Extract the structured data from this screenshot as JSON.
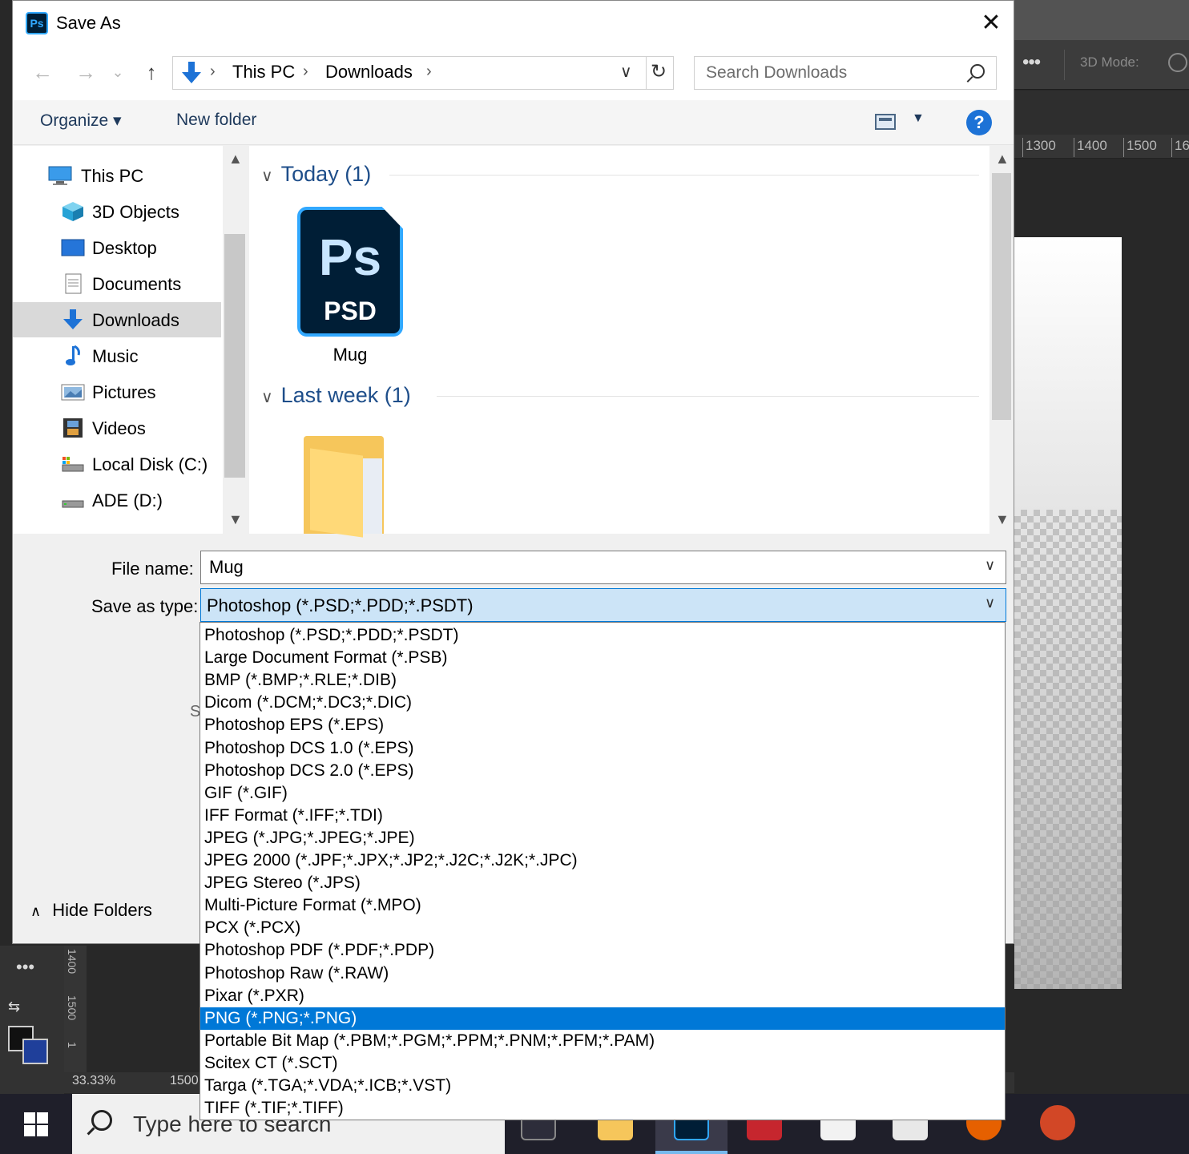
{
  "dialog": {
    "title": "Save As",
    "app_icon_text": "Ps",
    "close_glyph": "✕"
  },
  "nav": {
    "back_glyph": "←",
    "forward_glyph": "→",
    "recent_glyph": "⌄",
    "up_glyph": "↑",
    "breadcrumbs": [
      "This PC",
      "Downloads"
    ],
    "sep_glyph": "›",
    "dropdown_glyph": "∨",
    "refresh_glyph": "↻"
  },
  "search": {
    "placeholder": "Search Downloads"
  },
  "toolbar": {
    "organize": "Organize ▾",
    "new_folder": "New folder",
    "view_dd": "▼",
    "help": "?"
  },
  "sidebar": {
    "items": [
      {
        "label": "This PC",
        "icon": "computer-icon"
      },
      {
        "label": "3D Objects",
        "icon": "cube-icon"
      },
      {
        "label": "Desktop",
        "icon": "desktop-icon"
      },
      {
        "label": "Documents",
        "icon": "document-icon"
      },
      {
        "label": "Downloads",
        "icon": "download-icon",
        "selected": true
      },
      {
        "label": "Music",
        "icon": "music-note-icon"
      },
      {
        "label": "Pictures",
        "icon": "pictures-icon"
      },
      {
        "label": "Videos",
        "icon": "film-icon"
      },
      {
        "label": "Local Disk (C:)",
        "icon": "drive-icon"
      },
      {
        "label": "ADE (D:)",
        "icon": "drive-icon"
      }
    ]
  },
  "content": {
    "groups": [
      {
        "label": "Today (1)"
      },
      {
        "label": "Last week (1)"
      }
    ],
    "file": {
      "name": "Mug",
      "icon_ps": "Ps",
      "icon_type": "PSD"
    }
  },
  "form": {
    "file_name_label": "File name:",
    "file_name_value": "Mug",
    "save_as_type_label": "Save as type:",
    "save_as_type_value": "Photoshop (*.PSD;*.PDD;*.PSDT)",
    "hide_folders": "Hide Folders",
    "hidden_fragment": "S"
  },
  "type_options": [
    "Photoshop (*.PSD;*.PDD;*.PSDT)",
    "Large Document Format (*.PSB)",
    "BMP (*.BMP;*.RLE;*.DIB)",
    "Dicom (*.DCM;*.DC3;*.DIC)",
    "Photoshop EPS (*.EPS)",
    "Photoshop DCS 1.0 (*.EPS)",
    "Photoshop DCS 2.0 (*.EPS)",
    "GIF (*.GIF)",
    "IFF Format (*.IFF;*.TDI)",
    "JPEG (*.JPG;*.JPEG;*.JPE)",
    "JPEG 2000 (*.JPF;*.JPX;*.JP2;*.J2C;*.J2K;*.JPC)",
    "JPEG Stereo (*.JPS)",
    "Multi-Picture Format (*.MPO)",
    "PCX (*.PCX)",
    "Photoshop PDF (*.PDF;*.PDP)",
    "Photoshop Raw (*.RAW)",
    "Pixar (*.PXR)",
    "PNG (*.PNG;*.PNG)",
    "Portable Bit Map (*.PBM;*.PGM;*.PPM;*.PNM;*.PFM;*.PAM)",
    "Scitex CT (*.SCT)",
    "Targa (*.TGA;*.VDA;*.ICB;*.VST)",
    "TIFF (*.TIF;*.TIFF)"
  ],
  "highlighted_option": "PNG (*.PNG;*.PNG)",
  "photoshop": {
    "mode_label": "3D Mode:",
    "ruler_ticks": [
      "1300",
      "1400",
      "1500",
      "16"
    ],
    "zoom": "33.33%",
    "status_dim": "1500",
    "vruler_ticks": [
      "1400",
      "1500",
      "1"
    ]
  },
  "taskbar": {
    "search_placeholder": "Type here to search"
  },
  "colors": {
    "accent": "#0078d7",
    "ps_blue": "#31a8ff",
    "ps_dark": "#001e36",
    "header_text": "#1e4e8a"
  }
}
